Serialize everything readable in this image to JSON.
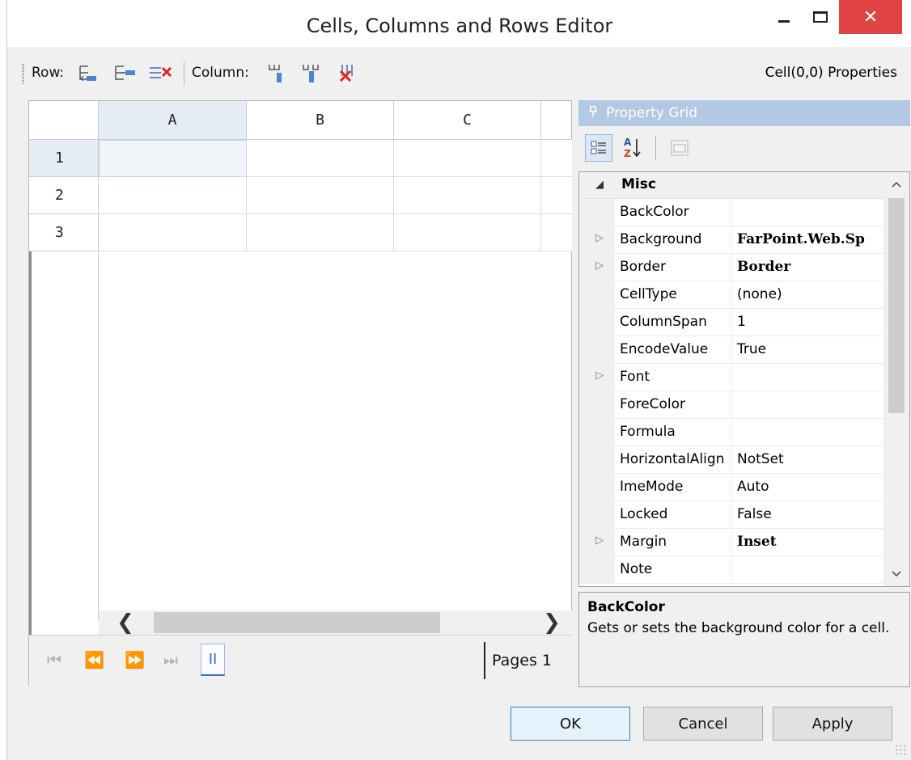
{
  "window": {
    "title": "Cells, Columns and Rows Editor",
    "close_glyph": "✕"
  },
  "toolbar": {
    "row_label": "Row:",
    "column_label": "Column:",
    "cell_properties": "Cell(0,0) Properties",
    "icons": [
      "insert-row-icon",
      "add-row-icon",
      "delete-row-icon",
      "insert-column-icon",
      "add-column-icon",
      "delete-column-icon"
    ]
  },
  "sheet": {
    "columns": [
      "A",
      "B",
      "C"
    ],
    "rows": [
      "1",
      "2",
      "3"
    ],
    "scroll_left": "❮",
    "scroll_right": "❯"
  },
  "pager": {
    "first": "⏮",
    "prev": "⏪",
    "next": "⏩",
    "last": "⏭",
    "pause": "II",
    "pages_text": "Pages 1"
  },
  "property_grid": {
    "caption": "Property Grid",
    "pin_glyph": "🖈",
    "alpha_glyph": "A\nZ↓",
    "category": "Misc",
    "properties": [
      {
        "name": "BackColor",
        "value": "",
        "expandable": false,
        "bold": false
      },
      {
        "name": "Background",
        "value": "FarPoint.Web.Sp",
        "expandable": true,
        "bold": true
      },
      {
        "name": "Border",
        "value": "Border",
        "expandable": true,
        "bold": true
      },
      {
        "name": "CellType",
        "value": "(none)",
        "expandable": false,
        "bold": false
      },
      {
        "name": "ColumnSpan",
        "value": "1",
        "expandable": false,
        "bold": false
      },
      {
        "name": "EncodeValue",
        "value": "True",
        "expandable": false,
        "bold": false
      },
      {
        "name": "Font",
        "value": "",
        "expandable": true,
        "bold": false
      },
      {
        "name": "ForeColor",
        "value": "",
        "expandable": false,
        "bold": false
      },
      {
        "name": "Formula",
        "value": "",
        "expandable": false,
        "bold": false
      },
      {
        "name": "HorizontalAlign",
        "value": "NotSet",
        "expandable": false,
        "bold": false
      },
      {
        "name": "ImeMode",
        "value": "Auto",
        "expandable": false,
        "bold": false
      },
      {
        "name": "Locked",
        "value": "False",
        "expandable": false,
        "bold": false
      },
      {
        "name": "Margin",
        "value": "Inset",
        "expandable": true,
        "bold": true
      },
      {
        "name": "Note",
        "value": "",
        "expandable": false,
        "bold": false
      }
    ],
    "description_title": "BackColor",
    "description_text": "Gets or sets the background color for a cell."
  },
  "buttons": {
    "ok": "OK",
    "cancel": "Cancel",
    "apply": "Apply"
  },
  "colors": {
    "close_button": "#e04343",
    "caption_bar": "#b3c8e2",
    "selected_header": "#e6ecf4",
    "pager_accent": "#3d6fc4"
  }
}
